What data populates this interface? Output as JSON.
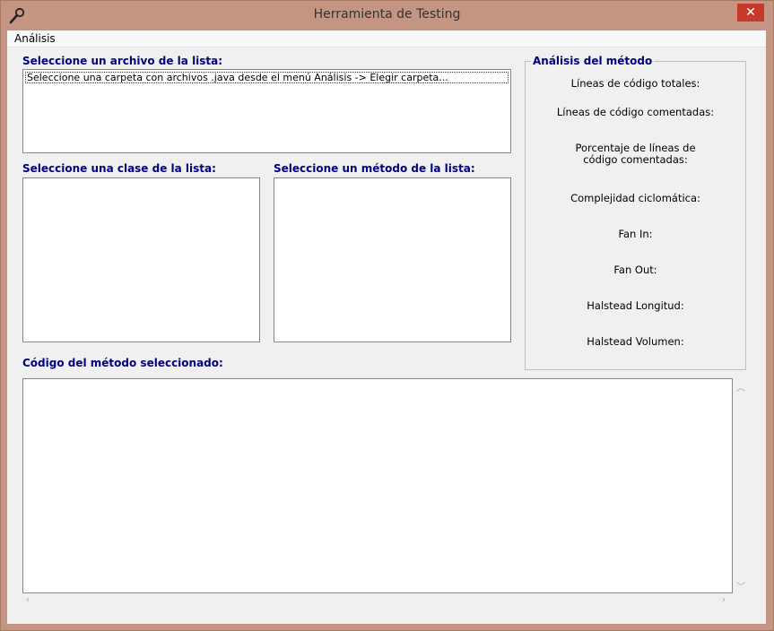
{
  "window": {
    "title": "Herramienta de Testing",
    "close_label": "✕"
  },
  "menu": {
    "items": [
      {
        "label": "Análisis"
      }
    ]
  },
  "files": {
    "label": "Seleccione un archivo de la lista:",
    "items": [
      "Seleccione una carpeta con archivos .java desde el menú Análisis -> Elegir carpeta..."
    ]
  },
  "classes": {
    "label": "Seleccione una clase de la lista:"
  },
  "methods": {
    "label": "Seleccione un método de la lista:"
  },
  "code": {
    "label": "Código del método seleccionado:"
  },
  "analysis": {
    "title": "Análisis del método",
    "metrics": [
      "Líneas de código totales:",
      "Líneas de código comentadas:",
      "Porcentaje de líneas de código comentadas:",
      "Complejidad ciclomática:",
      "Fan In:",
      "Fan Out:",
      "Halstead Longitud:",
      "Halstead Volumen:"
    ]
  },
  "colors": {
    "frame": "#c49583",
    "close": "#c7392b",
    "label_text": "#000080"
  }
}
